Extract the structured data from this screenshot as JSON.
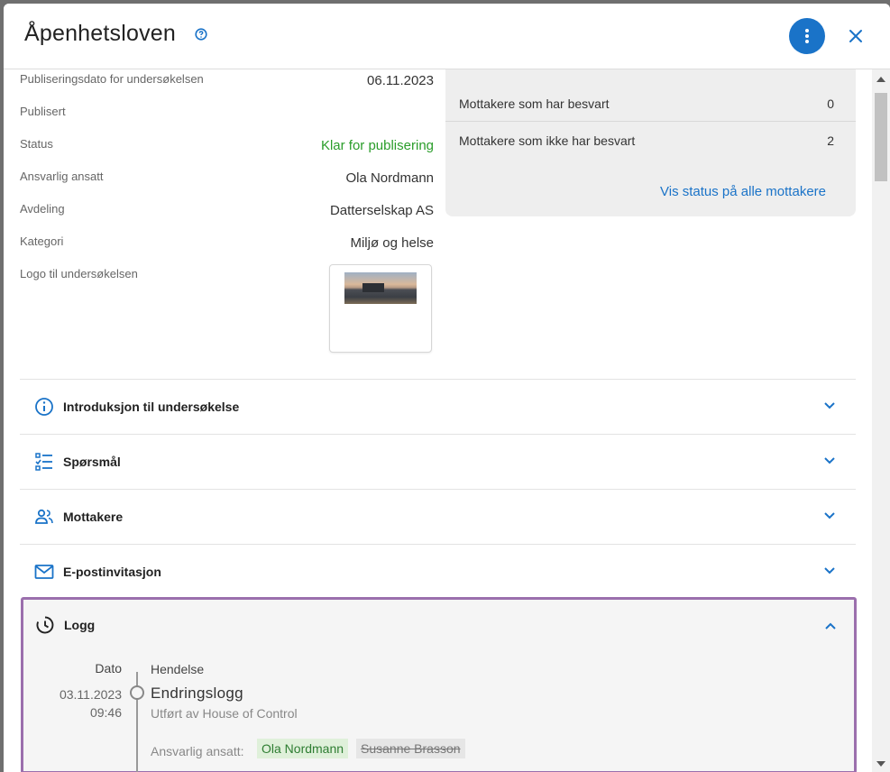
{
  "header": {
    "title": "Åpenhetsloven"
  },
  "details": {
    "publish_date_label": "Publiseringsdato for undersøkelsen",
    "publish_date_value": "06.11.2023",
    "published_label": "Publisert",
    "status_label": "Status",
    "status_value": "Klar for publisering",
    "owner_label": "Ansvarlig ansatt",
    "owner_value": "Ola Nordmann",
    "department_label": "Avdeling",
    "department_value": "Datterselskap AS",
    "category_label": "Kategori",
    "category_value": "Miljø og helse",
    "logo_label": "Logo til undersøkelsen"
  },
  "stats": {
    "answered_label": "Mottakere som har besvart",
    "answered_value": "0",
    "not_answered_label": "Mottakere som ikke har besvart",
    "not_answered_value": "2",
    "link": "Vis status på alle mottakere"
  },
  "sections": [
    {
      "label": "Introduksjon til undersøkelse",
      "icon": "info-icon"
    },
    {
      "label": "Spørsmål",
      "icon": "checklist-icon"
    },
    {
      "label": "Mottakere",
      "icon": "people-icon"
    },
    {
      "label": "E-postinvitasjon",
      "icon": "mail-icon"
    }
  ],
  "log": {
    "label": "Logg",
    "icon": "history-icon",
    "col_date": "Dato",
    "col_event": "Hendelse",
    "entry": {
      "date": "03.11.2023",
      "time": "09:46",
      "title": "Endringslogg",
      "subtitle": "Utført av House of Control",
      "resp_label": "Ansvarlig ansatt:",
      "new_value": "Ola Nordmann",
      "old_value": "Susanne Brasson"
    }
  },
  "colors": {
    "accent": "#1a73c8",
    "status_green": "#2a9d2a",
    "highlight_border": "#9b6fad"
  }
}
